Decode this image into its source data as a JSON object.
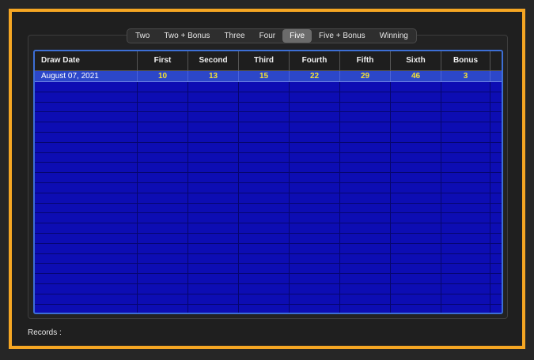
{
  "tabs": [
    {
      "label": "Two",
      "selected": false
    },
    {
      "label": "Two + Bonus",
      "selected": false
    },
    {
      "label": "Three",
      "selected": false
    },
    {
      "label": "Four",
      "selected": false
    },
    {
      "label": "Five",
      "selected": true
    },
    {
      "label": "Five + Bonus",
      "selected": false
    },
    {
      "label": "Winning",
      "selected": false
    }
  ],
  "table": {
    "columns": [
      "Draw Date",
      "First",
      "Second",
      "Third",
      "Fourth",
      "Fifth",
      "Sixth",
      "Bonus"
    ],
    "rows": [
      [
        "August 07, 2021",
        "10",
        "13",
        "15",
        "22",
        "29",
        "46",
        "3"
      ]
    ]
  },
  "footer": {
    "records_label": "Records :"
  },
  "colors": {
    "accent_frame": "#f5a623",
    "table_bg": "#0d0db3",
    "selected_row": "#2c47c9",
    "number_text": "#f2e033"
  }
}
